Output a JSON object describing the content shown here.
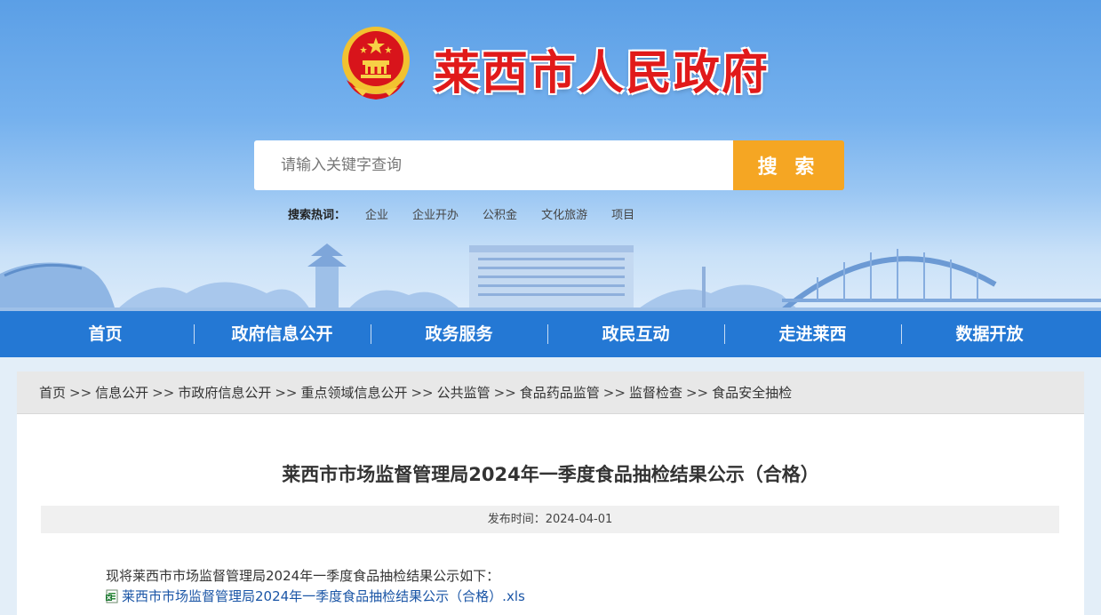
{
  "header": {
    "site_title": "莱西市人民政府",
    "search": {
      "placeholder": "请输入关键字查询",
      "button_label": "搜 索"
    },
    "hot_search": {
      "label": "搜索热词：",
      "terms": [
        "企业",
        "企业开办",
        "公积金",
        "文化旅游",
        "项目"
      ]
    }
  },
  "nav": {
    "items": [
      "首页",
      "政府信息公开",
      "政务服务",
      "政民互动",
      "走进莱西",
      "数据开放"
    ]
  },
  "breadcrumb": {
    "items": [
      "首页",
      "信息公开",
      "市政府信息公开",
      "重点领域信息公开",
      "公共监管",
      "食品药品监管",
      "监督检查",
      "食品安全抽检"
    ],
    "separator": ">>"
  },
  "article": {
    "title": "莱西市市场监督管理局2024年一季度食品抽检结果公示（合格）",
    "publish_time": "发布时间：2024-04-01",
    "intro": "现将莱西市市场监督管理局2024年一季度食品抽检结果公示如下：",
    "attachment_label": "莱西市市场监督管理局2024年一季度食品抽检结果公示（合格）.xls"
  },
  "colors": {
    "nav_bg": "#2478d4",
    "search_button": "#f5a623",
    "title_red": "#e11a1a",
    "link_blue": "#1a55a6"
  }
}
